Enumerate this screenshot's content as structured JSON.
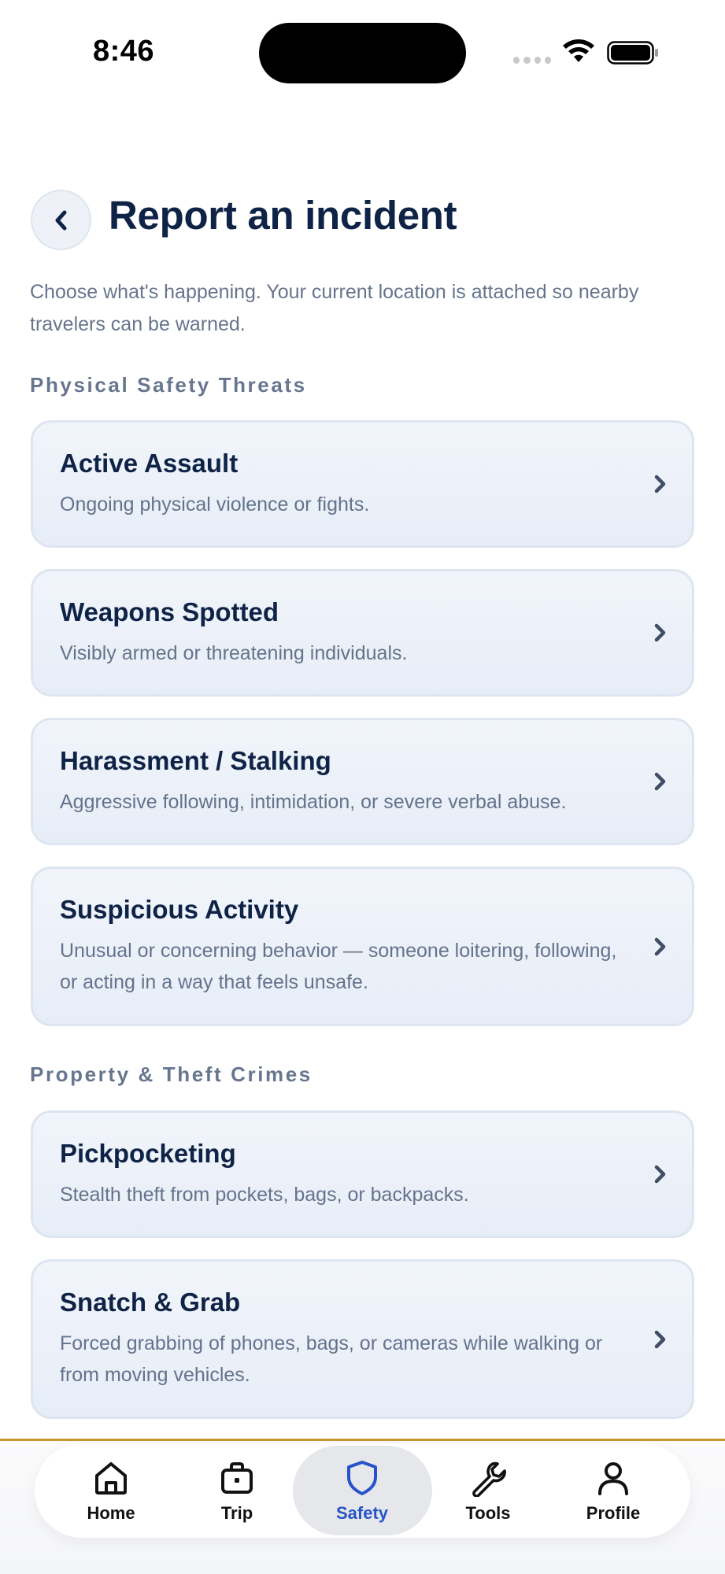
{
  "status_bar": {
    "time": "8:46"
  },
  "header": {
    "back_label": "‹",
    "title": "Report an incident",
    "intro": "Choose what's happening. Your current location is attached so nearby travelers can be warned."
  },
  "sections": [
    {
      "title": "Physical Safety Threats",
      "items": [
        {
          "title": "Active Assault",
          "desc": "Ongoing physical violence or fights."
        },
        {
          "title": "Weapons Spotted",
          "desc": "Visibly armed or threatening individuals."
        },
        {
          "title": "Harassment / Stalking",
          "desc": "Aggressive following, intimidation, or severe verbal abuse."
        },
        {
          "title": "Suspicious Activity",
          "desc": "Unusual or concerning behavior — someone loitering, following, or acting in a way that feels unsafe."
        }
      ]
    },
    {
      "title": "Property & Theft Crimes",
      "items": [
        {
          "title": "Pickpocketing",
          "desc": "Stealth theft from pockets, bags, or backpacks."
        },
        {
          "title": "Snatch & Grab",
          "desc": "Forced grabbing of phones, bags, or cameras while walking or from moving vehicles."
        }
      ]
    }
  ],
  "nav": {
    "items": [
      {
        "label": "Home",
        "icon": "home-icon"
      },
      {
        "label": "Trip",
        "icon": "briefcase-icon"
      },
      {
        "label": "Safety",
        "icon": "shield-icon",
        "active": true
      },
      {
        "label": "Tools",
        "icon": "wrench-icon"
      },
      {
        "label": "Profile",
        "icon": "person-icon"
      }
    ]
  },
  "colors": {
    "title": "#0f2347",
    "muted": "#64738c",
    "accent": "#2753c9",
    "divider": "#c9962f",
    "card_bg": "#eaf0f8"
  }
}
